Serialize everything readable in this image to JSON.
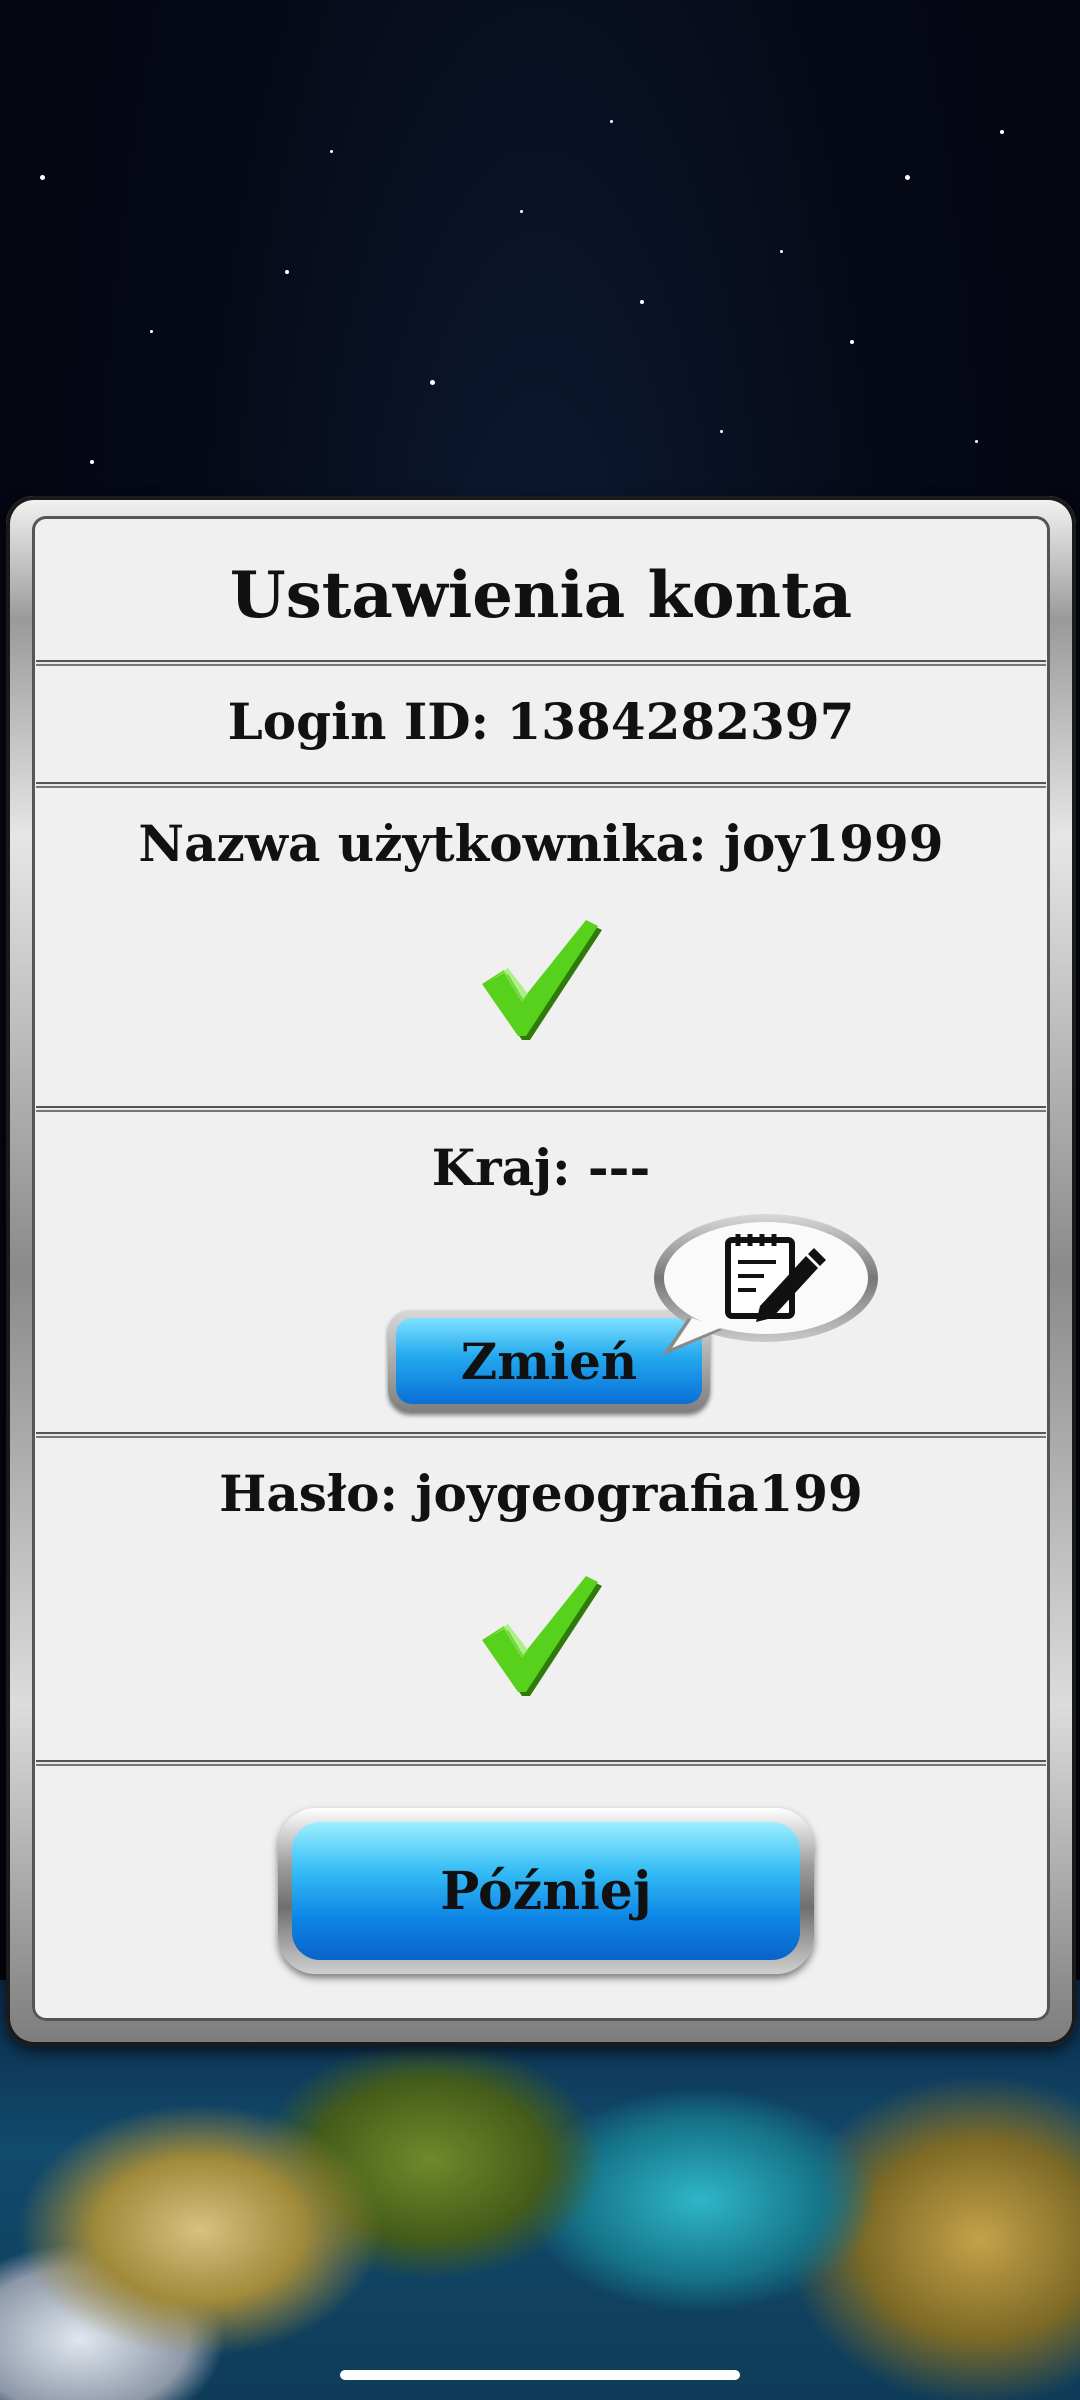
{
  "dialog": {
    "title": "Ustawienia konta",
    "login_id": "Login ID: 1384282397",
    "username": "Nazwa użytkownika: joy1999",
    "country": "Kraj: ---",
    "change_button": "Zmień",
    "password": "Hasło: joygeografia199",
    "later_button": "Później"
  },
  "icons": {
    "username_status": "check-icon",
    "password_status": "check-icon",
    "edit_bubble": "edit-note-icon"
  },
  "colors": {
    "check_green": "#57d11c",
    "button_blue": "#1a9be8"
  }
}
